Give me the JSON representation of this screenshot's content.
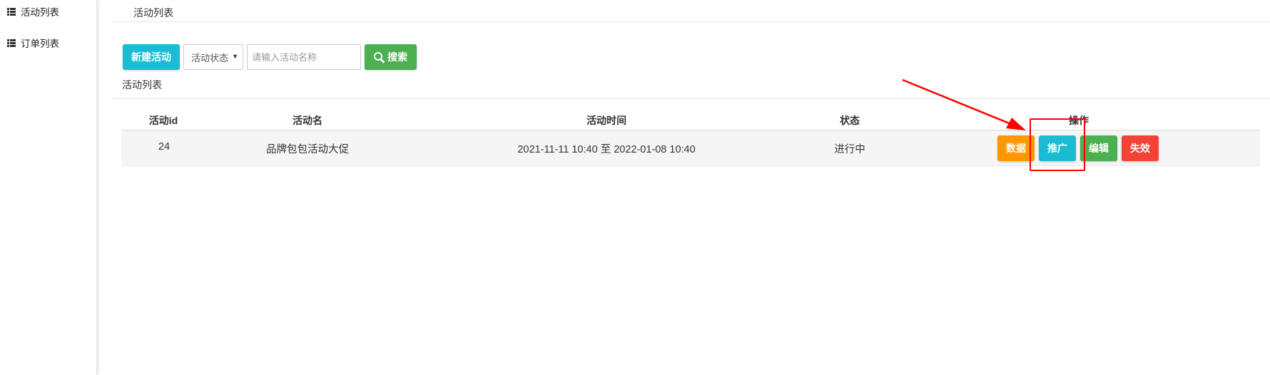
{
  "sidebar": {
    "items": [
      {
        "label": "活动列表",
        "icon": "list-icon"
      },
      {
        "label": "订单列表",
        "icon": "list-icon"
      }
    ]
  },
  "breadcrumb": {
    "current": "活动列表"
  },
  "toolbar": {
    "new_label": "新建活动",
    "status_select": {
      "selected": "活动状态"
    },
    "search_input": {
      "placeholder": "请输入活动名称",
      "value": ""
    },
    "search_label": "搜索",
    "search_icon": "search-icon"
  },
  "section": {
    "title": "活动列表"
  },
  "table": {
    "headers": {
      "id": "活动id",
      "name": "活动名",
      "time": "活动时间",
      "status": "状态",
      "ops": "操作"
    },
    "rows": [
      {
        "id": "24",
        "name": "品牌包包活动大促",
        "time": "2021-11-11 10:40 至 2022-01-08 10:40",
        "status": "进行中",
        "ops": {
          "data": "数据",
          "promote": "推广",
          "edit": "编辑",
          "disable": "失效"
        }
      }
    ]
  },
  "colors": {
    "primary_cyan": "#1bbcd3",
    "success_green": "#4caf50",
    "warning_orange": "#ff9800",
    "danger_red": "#f44336",
    "annotation_red": "#ff0000"
  }
}
